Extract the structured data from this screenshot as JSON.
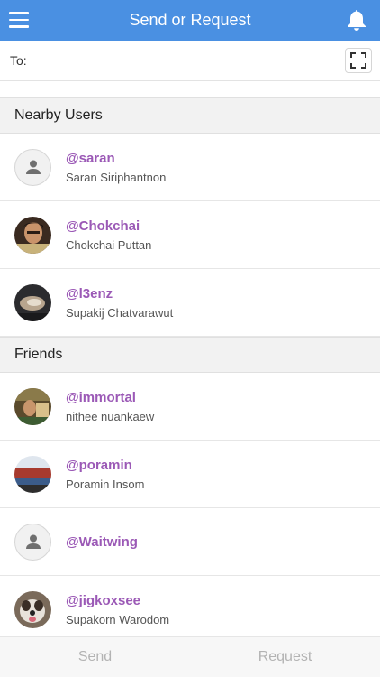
{
  "header": {
    "title": "Send or Request",
    "menu_icon": "hamburger-menu-icon",
    "notification_icon": "bell-icon",
    "color": "#4a90e2"
  },
  "to_field": {
    "label": "To:",
    "value": "",
    "placeholder": "",
    "scan_icon": "qr-scan-icon"
  },
  "sections": [
    {
      "title": "Nearby Users",
      "users": [
        {
          "username": "@saran",
          "name": "Saran Siriphantnon",
          "avatar": "default"
        },
        {
          "username": "@Chokchai",
          "name": "Chokchai Puttan",
          "avatar": "photo"
        },
        {
          "username": "@l3enz",
          "name": "Supakij Chatvarawut",
          "avatar": "photo"
        }
      ]
    },
    {
      "title": "Friends",
      "users": [
        {
          "username": "@immortal",
          "name": "nithee nuankaew",
          "avatar": "photo"
        },
        {
          "username": "@poramin",
          "name": "Poramin Insom",
          "avatar": "photo"
        },
        {
          "username": "@Waitwing",
          "name": "",
          "avatar": "default"
        },
        {
          "username": "@jigkoxsee",
          "name": "Supakorn Warodom",
          "avatar": "photo"
        }
      ]
    }
  ],
  "bottom_bar": {
    "send_label": "Send",
    "request_label": "Request"
  },
  "colors": {
    "username": "#9b59b6",
    "section_bg": "#f2f2f2"
  }
}
